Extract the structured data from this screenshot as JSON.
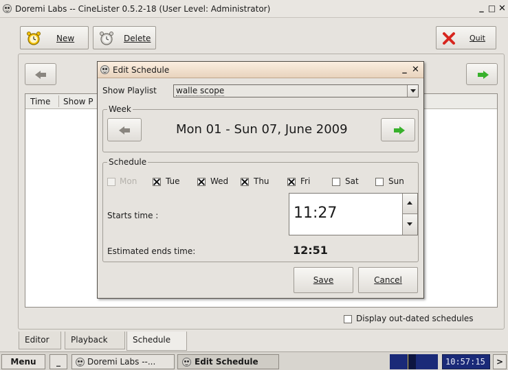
{
  "window": {
    "title": "Doremi Labs -- CineLister 0.5.2-18 (User Level: Administrator)",
    "minimize": "_",
    "maximize": "□",
    "close": "✕"
  },
  "toolbar": {
    "new_label": "New",
    "delete_label": "Delete",
    "quit_label": "Quit"
  },
  "table": {
    "columns": [
      "Time",
      "Show P"
    ]
  },
  "options": {
    "display_outdated_label": "Display out-dated schedules",
    "display_outdated_checked": false
  },
  "tabs": [
    {
      "label": "Editor",
      "active": false
    },
    {
      "label": "Playback",
      "active": false
    },
    {
      "label": "Schedule",
      "active": true
    }
  ],
  "taskbar": {
    "menu_label": "Menu",
    "desktop_label": "_",
    "task1_label": "Doremi Labs --...",
    "task2_label": "Edit Schedule",
    "clock": "10:57:15",
    "more_label": ">"
  },
  "dialog": {
    "title": "Edit Schedule",
    "minimize": "_",
    "close": "✕",
    "show_playlist_label": "Show Playlist",
    "show_playlist_value": "walle scope",
    "week_group_title": "Week",
    "week_range": "Mon 01 - Sun 07, June 2009",
    "schedule_group_title": "Schedule",
    "days": [
      {
        "label": "Mon",
        "checked": false,
        "enabled": false
      },
      {
        "label": "Tue",
        "checked": true,
        "enabled": true
      },
      {
        "label": "Wed",
        "checked": true,
        "enabled": true
      },
      {
        "label": "Thu",
        "checked": true,
        "enabled": true
      },
      {
        "label": "Fri",
        "checked": true,
        "enabled": true
      },
      {
        "label": "Sat",
        "checked": false,
        "enabled": true
      },
      {
        "label": "Sun",
        "checked": false,
        "enabled": true
      }
    ],
    "starts_time_label": "Starts time :",
    "starts_time_value": "11:27",
    "estimated_end_label": "Estimated ends time:",
    "estimated_end_value": "12:51",
    "save_label": "Save",
    "cancel_label": "Cancel"
  },
  "colors": {
    "nav_arrow_gray": "#8a8680",
    "nav_arrow_green": "#38b12c",
    "quit_red": "#d7261f",
    "clock_bg": "#1a2a78",
    "dialog_title_bg": "#f3e0cc"
  },
  "icons": {
    "new": "alarm-clock-icon",
    "delete": "alarm-clock-icon",
    "quit": "red-x-icon",
    "prev": "arrow-left-icon",
    "next": "arrow-right-icon"
  }
}
